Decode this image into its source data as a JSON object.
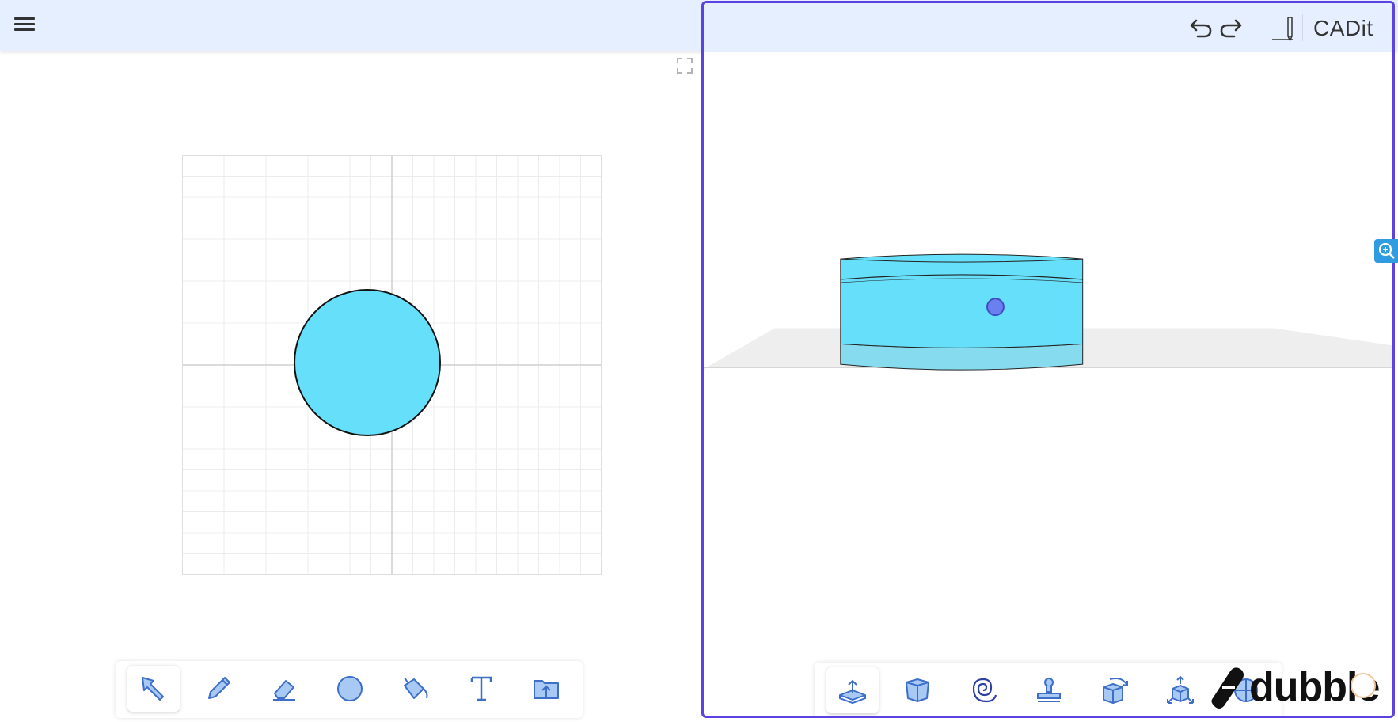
{
  "app": {
    "title": "CADit"
  },
  "header": {
    "menu_icon": "hamburger-menu-icon",
    "undo_icon": "undo-icon",
    "redo_icon": "redo-icon",
    "sketch_icon": "pencil-sketch-icon"
  },
  "sketch_toolbar": {
    "tools": [
      {
        "name": "select",
        "icon": "arrow-cursor-icon",
        "active": true
      },
      {
        "name": "pencil",
        "icon": "pencil-icon",
        "active": false
      },
      {
        "name": "eraser",
        "icon": "eraser-icon",
        "active": false
      },
      {
        "name": "circle",
        "icon": "circle-icon",
        "active": false
      },
      {
        "name": "fill",
        "icon": "paint-bucket-icon",
        "active": false
      },
      {
        "name": "text",
        "icon": "text-icon",
        "active": false
      },
      {
        "name": "open-folder",
        "icon": "folder-upload-icon",
        "active": false
      }
    ]
  },
  "model_toolbar": {
    "tools": [
      {
        "name": "extrude",
        "icon": "extrude-icon",
        "active": true
      },
      {
        "name": "box",
        "icon": "box-icon",
        "active": false
      },
      {
        "name": "spiral",
        "icon": "spiral-icon",
        "active": false
      },
      {
        "name": "stamp",
        "icon": "stamp-icon",
        "active": false
      },
      {
        "name": "rotate",
        "icon": "rotate-cube-icon",
        "active": false
      },
      {
        "name": "scale",
        "icon": "scale-cube-icon",
        "active": false
      },
      {
        "name": "more",
        "icon": "globe-icon",
        "active": false
      }
    ]
  },
  "colors": {
    "accent": "#5a43e0",
    "header_bg": "#e6efff",
    "shape_fill": "#66e0fa",
    "shape_fill_lower": "#86dbef",
    "handle": "#6b7ff0",
    "icon_blue": "#3d6fc9",
    "zoom_tab": "#2f9be0"
  },
  "watermark": {
    "text": "dubble"
  }
}
